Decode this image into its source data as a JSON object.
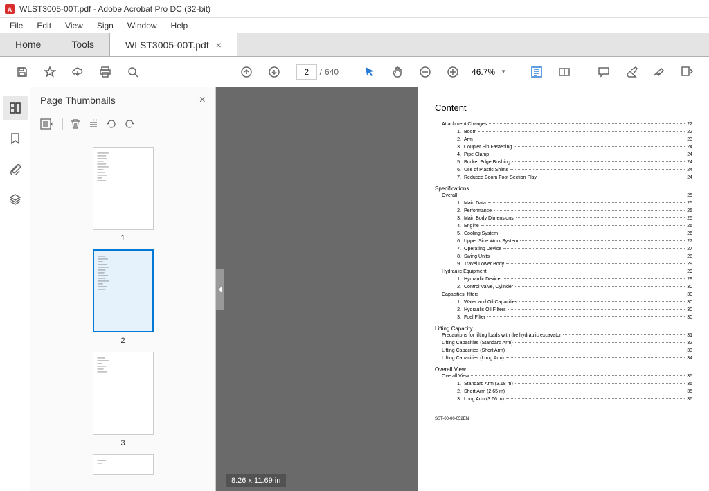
{
  "window": {
    "title": "WLST3005-00T.pdf - Adobe Acrobat Pro DC (32-bit)"
  },
  "menu": {
    "file": "File",
    "edit": "Edit",
    "view": "View",
    "sign": "Sign",
    "window": "Window",
    "help": "Help"
  },
  "tabs": {
    "home": "Home",
    "tools": "Tools",
    "doc": "WLST3005-00T.pdf"
  },
  "toolbar": {
    "page_current": "2",
    "page_sep": "/",
    "page_total": "640",
    "zoom": "46.7%"
  },
  "thumbs": {
    "title": "Page Thumbnails",
    "p1": "1",
    "p2": "2",
    "p3": "3"
  },
  "viewer": {
    "dims": "8.26 x 11.69 in"
  },
  "doc": {
    "title": "Content",
    "s1": "Attachment Changes",
    "s1p": "22",
    "a1": "1.",
    "a1t": "Boom",
    "a1p": "22",
    "a2": "2.",
    "a2t": "Arm",
    "a2p": "23",
    "a3": "3.",
    "a3t": "Coupler Pin Fastening",
    "a3p": "24",
    "a4": "4.",
    "a4t": "Pipe Clamp",
    "a4p": "24",
    "a5": "5.",
    "a5t": "Bucket Edge Bushing",
    "a5p": "24",
    "a6": "6.",
    "a6t": "Use of Plastic Shims",
    "a6p": "24",
    "a7": "7.",
    "a7t": "Reduced Boom Foot Section Play",
    "a7p": "24",
    "s2": "Specifications",
    "b0t": "Overall",
    "b0p": "25",
    "b1": "1.",
    "b1t": "Main Data",
    "b1p": "25",
    "b2": "2.",
    "b2t": "Performance",
    "b2p": "25",
    "b3": "3.",
    "b3t": "Main Body Dimensions",
    "b3p": "25",
    "b4": "4.",
    "b4t": "Engine",
    "b4p": "26",
    "b5": "5.",
    "b5t": "Cooling System",
    "b5p": "26",
    "b6": "6.",
    "b6t": "Upper Side Work System",
    "b6p": "27",
    "b7": "7.",
    "b7t": "Operating Device",
    "b7p": "27",
    "b8": "8.",
    "b8t": "Swing Units",
    "b8p": "28",
    "b9": "9.",
    "b9t": "Travel Lower Body",
    "b9p": "29",
    "c0t": "Hydraulic Equipment",
    "c0p": "29",
    "c1": "1.",
    "c1t": "Hydraulic Device",
    "c1p": "29",
    "c2": "2.",
    "c2t": "Control Valve, Cylinder",
    "c2p": "30",
    "d0t": "Capacities, filters",
    "d0p": "30",
    "d1": "1.",
    "d1t": "Water and Oil Capacities",
    "d1p": "30",
    "d2": "2.",
    "d2t": "Hydraulic Oil Filters",
    "d2p": "30",
    "d3": "3.",
    "d3t": "Fuel Filter",
    "d3p": "30",
    "s3": "Lifting Capacity",
    "e1t": "Precautions for lifting loads with the hydraulic excavator",
    "e1p": "31",
    "e2t": "Lifting Capacities (Standard Arm)",
    "e2p": "32",
    "e3t": "Lifting Capacities (Short Arm)",
    "e3p": "33",
    "e4t": "Lifting Capacities (Long Arm)",
    "e4p": "34",
    "s4": "Overall View",
    "f0t": "Overall View",
    "f0p": "35",
    "f1": "1.",
    "f1t": "Standard Arm (3.18 m)",
    "f1p": "35",
    "f2": "2.",
    "f2t": "Short Arm (2.65 m)",
    "f2p": "35",
    "f3": "3.",
    "f3t": "Long Arm (3.66 m)",
    "f3p": "36",
    "footer": "SST-00-00-052EN"
  }
}
